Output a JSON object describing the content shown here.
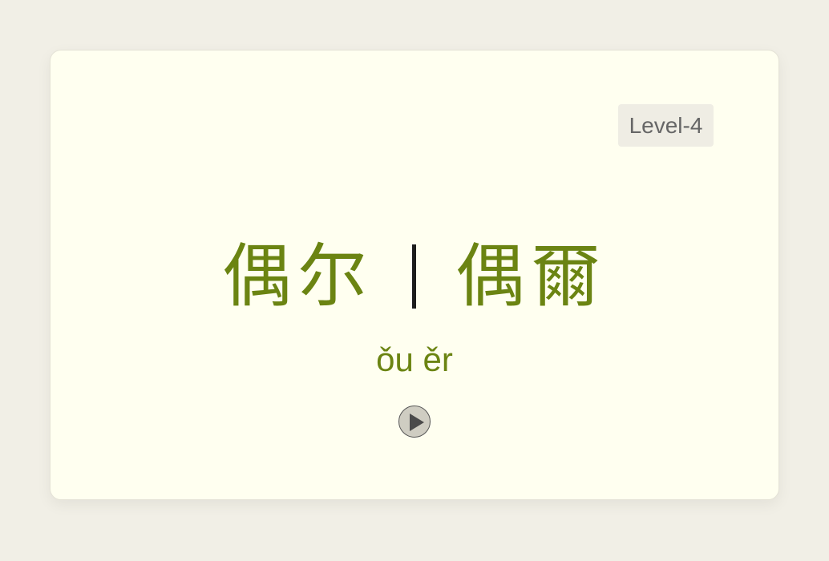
{
  "card": {
    "level": "Level-4",
    "simplified": "偶尔",
    "traditional": "偶爾",
    "pinyin": "ǒu ěr"
  },
  "icons": {
    "play": "play-icon"
  },
  "colors": {
    "hanzi": "#6b8412",
    "pinyin": "#6b8412",
    "background": "#f1efe6",
    "card": "#fffff0"
  }
}
